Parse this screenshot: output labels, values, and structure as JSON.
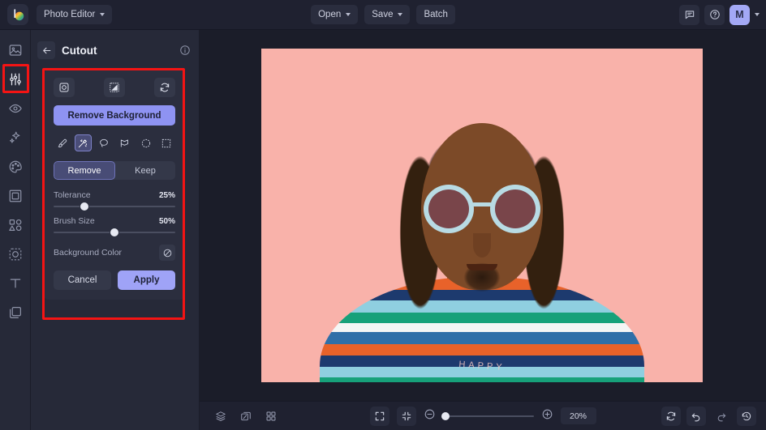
{
  "app": {
    "logo_icon": "brand-logo-icon",
    "menu_label": "Photo Editor"
  },
  "topbar": {
    "open_label": "Open",
    "save_label": "Save",
    "batch_label": "Batch",
    "feedback_icon": "comment-icon",
    "help_icon": "question-circle-icon",
    "avatar_initial": "M"
  },
  "rail": {
    "items": [
      {
        "icon": "image-icon",
        "name": "sidebar-item-image"
      },
      {
        "icon": "adjust-sliders-icon",
        "name": "sidebar-item-adjust"
      },
      {
        "icon": "eye-icon",
        "name": "sidebar-item-retouch"
      },
      {
        "icon": "sparkles-icon",
        "name": "sidebar-item-effects"
      },
      {
        "icon": "palette-icon",
        "name": "sidebar-item-color"
      },
      {
        "icon": "frame-icon",
        "name": "sidebar-item-frame"
      },
      {
        "icon": "shapes-icon",
        "name": "sidebar-item-shapes"
      },
      {
        "icon": "cutout-icon",
        "name": "sidebar-item-cutout"
      },
      {
        "icon": "text-icon",
        "name": "sidebar-item-text"
      },
      {
        "icon": "layers-copy-icon",
        "name": "sidebar-item-layers"
      }
    ]
  },
  "panel": {
    "back_icon": "arrow-left-icon",
    "title": "Cutout",
    "info_icon": "info-circle-icon",
    "modes": [
      {
        "icon": "object-select-icon",
        "name": "mode-object-select"
      },
      {
        "icon": "transparency-checker-icon",
        "name": "mode-transparency"
      },
      {
        "icon": "refresh-swap-icon",
        "name": "mode-refresh"
      }
    ],
    "remove_background_label": "Remove Background",
    "tools": [
      {
        "icon": "brush-icon",
        "name": "tool-brush",
        "selected": false
      },
      {
        "icon": "magic-wand-icon",
        "name": "tool-magic-wand",
        "selected": true
      },
      {
        "icon": "lasso-icon",
        "name": "tool-lasso",
        "selected": false
      },
      {
        "icon": "polygon-lasso-icon",
        "name": "tool-polygon-lasso",
        "selected": false
      },
      {
        "icon": "ellipse-select-icon",
        "name": "tool-ellipse-select",
        "selected": false
      },
      {
        "icon": "rectangle-select-icon",
        "name": "tool-rectangle-select",
        "selected": false
      }
    ],
    "segmented": {
      "remove_label": "Remove",
      "keep_label": "Keep",
      "active": "Remove"
    },
    "tolerance": {
      "label": "Tolerance",
      "value": "25%",
      "percent": 25
    },
    "brush_size": {
      "label": "Brush Size",
      "value": "50%",
      "percent": 50
    },
    "background_color": {
      "label": "Background Color",
      "swatch_icon": "no-color-slash-icon"
    },
    "cancel_label": "Cancel",
    "apply_label": "Apply"
  },
  "canvas": {
    "background_color": "#f9b2aa",
    "shirt_text": "HAPPY"
  },
  "bottombar": {
    "left": [
      {
        "icon": "layers-stack-icon",
        "name": "layers-button"
      },
      {
        "icon": "compare-icon",
        "name": "compare-button"
      },
      {
        "icon": "grid-icon",
        "name": "grid-button"
      }
    ],
    "fit_icon": "fit-screen-icon",
    "actual_icon": "shrink-icon",
    "zoom_out_icon": "minus-circle-icon",
    "zoom_in_icon": "plus-circle-icon",
    "zoom_value": "20%",
    "right": [
      {
        "icon": "reset-icon",
        "name": "reset-button"
      },
      {
        "icon": "undo-icon",
        "name": "undo-button"
      },
      {
        "icon": "redo-icon",
        "name": "redo-button"
      },
      {
        "icon": "history-icon",
        "name": "history-button"
      }
    ]
  },
  "annotations": {
    "highlight_color": "#f41414",
    "boxes": [
      {
        "name": "highlight-rail-adjust"
      },
      {
        "name": "highlight-cutout-panel"
      }
    ]
  }
}
